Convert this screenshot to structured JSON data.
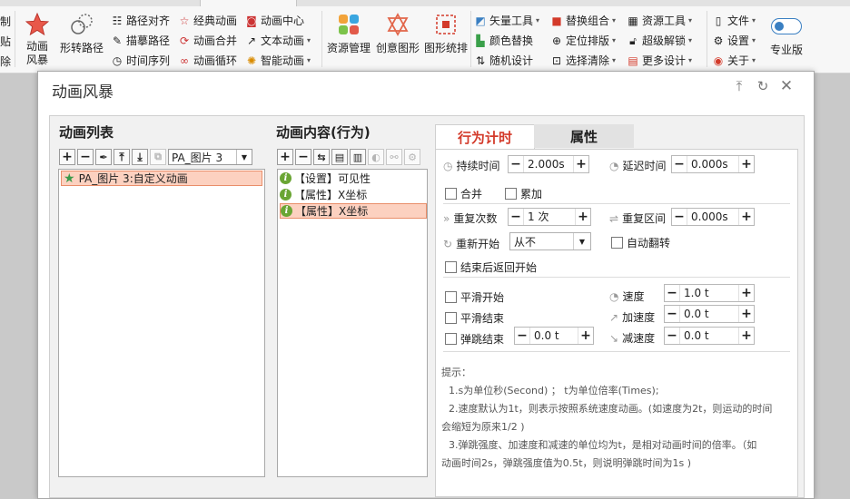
{
  "ribbon": {
    "left_partial": [
      "制",
      "贴",
      "除"
    ],
    "anim_storm": "动画风暴",
    "shape_path": "形转路径",
    "col1": [
      "路径对齐",
      "描摹路径",
      "时间序列"
    ],
    "col2": [
      "经典动画",
      "动画合并",
      "动画循环"
    ],
    "col3": [
      "动画中心",
      "文本动画",
      "智能动画"
    ],
    "resource_mgmt": "资源管理",
    "creative_shape": "创意图形",
    "shape_layout": "图形统排",
    "col4": [
      "矢量工具",
      "颜色替换",
      "随机设计"
    ],
    "col5": [
      "替换组合",
      "定位排版",
      "选择清除"
    ],
    "col6": [
      "资源工具",
      "超级解锁",
      "更多设计"
    ],
    "col7": [
      "文件",
      "设置",
      "关于"
    ],
    "pro_label": "专业版"
  },
  "dialog": {
    "title": "动画风暴",
    "list_pane": {
      "header": "动画列表",
      "select_value": "PA_图片 3",
      "items": [
        "PA_图片 3:自定义动画"
      ]
    },
    "content_pane": {
      "header": "动画内容(行为)",
      "items": [
        "【设置】可见性",
        "【属性】X坐标",
        "【属性】X坐标"
      ]
    },
    "tabs": {
      "timing": "行为计时",
      "props": "属性"
    },
    "timing": {
      "duration_label": "持续时间",
      "duration": "2.000s",
      "delay_label": "延迟时间",
      "delay": "0.000s",
      "merge": "合并",
      "accumulate": "累加",
      "repeat_label": "重复次数",
      "repeat": "1 次",
      "repeat_range_label": "重复区间",
      "repeat_range": "0.000s",
      "restart_label": "重新开始",
      "restart": "从不",
      "auto_reverse": "自动翻转",
      "return_start": "结束后返回开始",
      "smooth_start": "平滑开始",
      "smooth_end": "平滑结束",
      "bounce_end": "弹跳结束",
      "bounce": "0.0 t",
      "speed_label": "速度",
      "speed": "1.0 t",
      "accel_label": "加速度",
      "accel": "0.0 t",
      "decel_label": "减速度",
      "decel": "0.0 t"
    },
    "hint": {
      "title": "提示：",
      "l1": "1.s为单位秒(Second) ； t为单位倍率(Times);",
      "l2a": "2.速度默认为1t，则表示按照系统速度动画。(如速度为2t，则运动的时间",
      "l2b": "会缩短为原来1/2 )",
      "l3a": "3.弹跳强度、加速度和减速的单位均为t，是相对动画时间的倍率。（如",
      "l3b": "动画时间2s，弹跳强度值为0.5t，则说明弹跳时间为1s )"
    }
  },
  "colors": {
    "accent_red": "#d33a2a",
    "selected_bg": "#fcd1c0",
    "ok_green": "#6aa534"
  }
}
